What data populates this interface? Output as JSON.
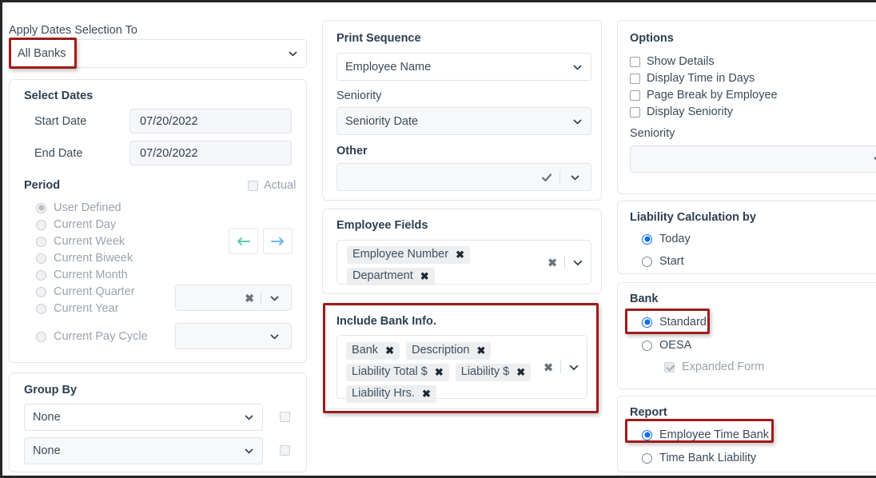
{
  "left": {
    "apply_label": "Apply Dates Selection To",
    "apply_value": "All Banks",
    "select_dates": {
      "title": "Select Dates",
      "start_label": "Start Date",
      "start_value": "07/20/2022",
      "end_label": "End Date",
      "end_value": "07/20/2022",
      "period_label": "Period",
      "actual_label": "Actual",
      "actual_checked": false,
      "periods": [
        {
          "label": "User Defined",
          "selected": true
        },
        {
          "label": "Current Day",
          "selected": false
        },
        {
          "label": "Current Week",
          "selected": false
        },
        {
          "label": "Current Biweek",
          "selected": false
        },
        {
          "label": "Current Month",
          "selected": false
        },
        {
          "label": "Current Quarter",
          "selected": false
        },
        {
          "label": "Current Year",
          "selected": false
        },
        {
          "label": "Current Pay Cycle",
          "selected": false
        }
      ],
      "quarter_value": "",
      "paycycle_value": ""
    },
    "group_by": {
      "title": "Group By",
      "first_value": "None",
      "second_value": "None",
      "first_checked": false,
      "second_checked": false
    }
  },
  "middle": {
    "print_sequence": {
      "title": "Print Sequence",
      "value": "Employee Name",
      "seniority_label": "Seniority",
      "seniority_value": "Seniority Date",
      "other_label": "Other",
      "other_value": ""
    },
    "employee_fields": {
      "title": "Employee Fields",
      "tags": [
        "Employee Number",
        "Department"
      ]
    },
    "include_bank_info": {
      "title": "Include Bank Info.",
      "tags": [
        "Bank",
        "Description",
        "Liability Total $",
        "Liability $",
        "Liability Hrs."
      ]
    }
  },
  "right": {
    "options": {
      "title": "Options",
      "checkboxes": [
        {
          "label": "Show Details",
          "checked": false
        },
        {
          "label": "Display Time in Days",
          "checked": false
        },
        {
          "label": "Page Break by Employee",
          "checked": false
        },
        {
          "label": "Display Seniority",
          "checked": false
        }
      ],
      "seniority_label": "Seniority",
      "seniority_value": ""
    },
    "liability_calc": {
      "title": "Liability Calculation by",
      "options": [
        {
          "label": "Today",
          "selected": true
        },
        {
          "label": "Start",
          "selected": false
        }
      ]
    },
    "bank": {
      "title": "Bank",
      "options": [
        {
          "label": "Standard",
          "selected": true
        },
        {
          "label": "OESA",
          "selected": false
        }
      ],
      "expanded_form_label": "Expanded Form",
      "expanded_form_checked": true
    },
    "report": {
      "title": "Report",
      "options": [
        {
          "label": "Employee Time Bank",
          "selected": true
        },
        {
          "label": "Time Bank Liability",
          "selected": false
        }
      ]
    }
  },
  "icons": {
    "chevron_down": "chevron-down-icon",
    "clear": "clear-icon",
    "check": "check-icon",
    "arrow_left": "arrow-left-icon",
    "arrow_right": "arrow-right-icon"
  },
  "colors": {
    "accent_blue": "#0d6efd",
    "highlight_red": "#9e1b1b",
    "arrow_left": "#5ec9b8",
    "arrow_right": "#6cb8ec",
    "chip_bg": "#eceef0"
  }
}
